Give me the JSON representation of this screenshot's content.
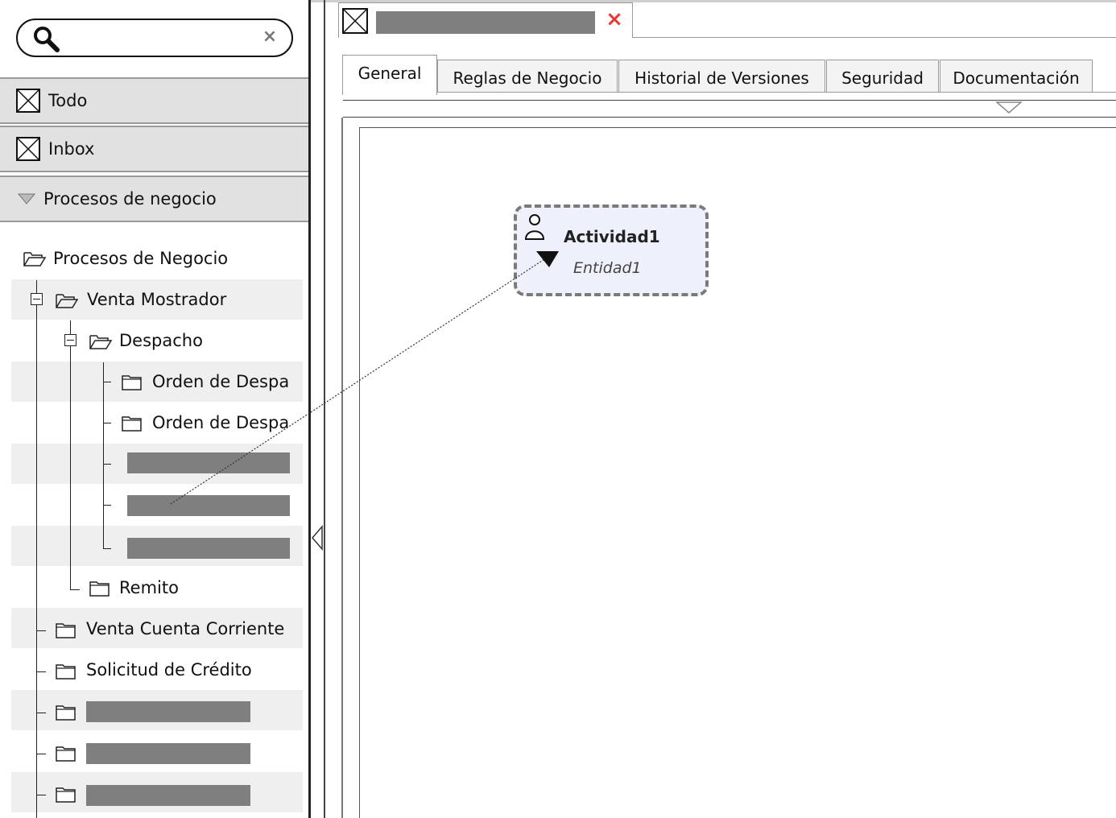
{
  "search": {
    "placeholder": "",
    "value": "",
    "clear_glyph": "×"
  },
  "sections": {
    "todo": "Todo",
    "inbox": "Inbox",
    "procesos": "Procesos de negocio"
  },
  "tree": {
    "root": "Procesos de Negocio",
    "venta_mostrador": "Venta Mostrador",
    "despacho": "Despacho",
    "orden1": "Orden de Despa",
    "orden2": "Orden de Despa",
    "remito": "Remito",
    "venta_cc": "Venta Cuenta Corriente",
    "solicitud": "Solicitud de Crédito"
  },
  "editor": {
    "close_glyph": "×",
    "tabs": [
      "General",
      "Reglas de Negocio",
      "Historial de Versiones",
      "Seguridad",
      "Documentación"
    ],
    "active_tab": "General"
  },
  "activity": {
    "name": "Actividad1",
    "entity": "Entidad1"
  },
  "icons": {
    "search": "search-icon",
    "clear": "clear-icon",
    "section": "broken-image-icon",
    "collapse": "triangle-down-icon",
    "folder_open": "folder-open-icon",
    "folder": "folder-icon",
    "user": "user-icon",
    "panel_collapse": "collapse-left-icon",
    "tab_close": "close-icon",
    "overflow": "chevron-down-icon"
  },
  "colors": {
    "section_bg": "#e1e1e1",
    "redaction": "#7f7f7f",
    "activity_bg": "#eef0fb",
    "close_red": "#e53935"
  }
}
